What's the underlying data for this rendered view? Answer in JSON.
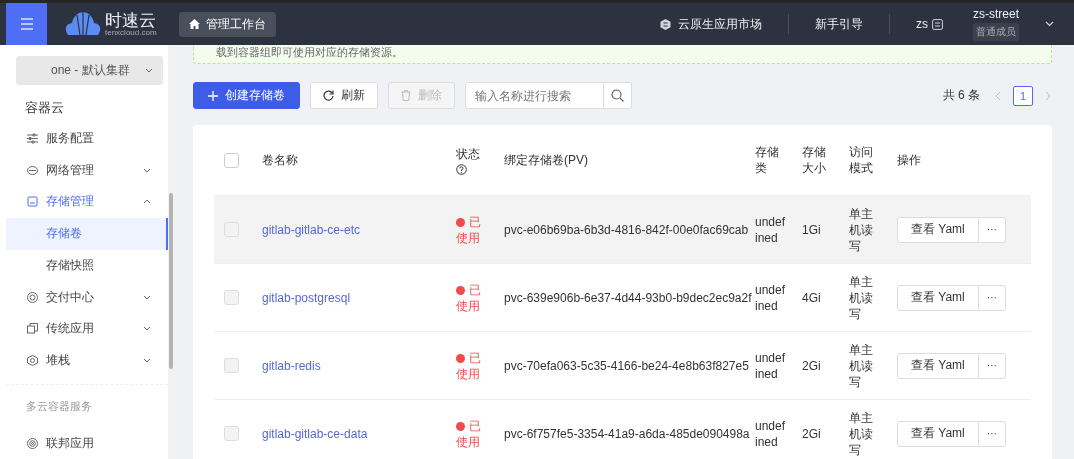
{
  "topbar": {
    "logo_text": "时速云",
    "logo_sub": "tenxcloud.com",
    "workspace": "管理工作台",
    "market": "云原生应用市场",
    "guide": "新手引导",
    "user_short": "zs",
    "user_name": "zs-street",
    "role": "普通成员"
  },
  "sidebar": {
    "cluster": "one - 默认集群",
    "section": "容器云",
    "items": [
      {
        "label": "服务配置",
        "kind": "config",
        "active": false
      },
      {
        "label": "网络管理",
        "kind": "network",
        "expanded": false,
        "active": false
      },
      {
        "label": "存储管理",
        "kind": "storage",
        "expanded": true,
        "active": true,
        "children": [
          {
            "label": "存储卷",
            "selected": true
          },
          {
            "label": "存储快照",
            "selected": false
          }
        ]
      },
      {
        "label": "交付中心",
        "kind": "delivery",
        "expanded": false,
        "active": false
      },
      {
        "label": "传统应用",
        "kind": "app",
        "expanded": false,
        "active": false
      },
      {
        "label": "堆栈",
        "kind": "stack",
        "expanded": false,
        "active": false
      }
    ],
    "group_label": "多云容器服务",
    "group_items": [
      {
        "label": "联邦应用",
        "kind": "federation"
      }
    ]
  },
  "notice": "载到容器组即可使用对应的存储资源。",
  "toolbar": {
    "create": "创建存储卷",
    "refresh": "刷新",
    "delete": {
      "label": "删除",
      "disabled": true
    },
    "search": {
      "placeholder": "输入名称进行搜索"
    }
  },
  "pagination": {
    "total": "共 6 条",
    "pages": [
      {
        "label": "1",
        "selected": true
      }
    ]
  },
  "table": {
    "columns": [
      "卷名称",
      "状态",
      "绑定存储卷(PV)",
      "存储类",
      "存储大小",
      "访问模式",
      "操作"
    ],
    "header_checked": false,
    "rows": [
      {
        "checked": false,
        "hovered": true,
        "name": "gitlab-gitlab-ce-etc",
        "status": "已使用",
        "color": "#f04b4b",
        "pv": "pvc-e06b69ba-6b3d-4816-842f-00e0fac69cab",
        "storage_class": "undefined",
        "size": "1Gi",
        "access": "单主机读写",
        "action": "查看 Yaml",
        "more": "···"
      },
      {
        "checked": false,
        "hovered": false,
        "name": "gitlab-postgresql",
        "status": "已使用",
        "color": "#f04b4b",
        "pv": "pvc-639e906b-6e37-4d44-93b0-b9dec2ec9a2f",
        "storage_class": "undefined",
        "size": "4Gi",
        "access": "单主机读写",
        "action": "查看 Yaml",
        "more": "···"
      },
      {
        "checked": false,
        "hovered": false,
        "name": "gitlab-redis",
        "status": "已使用",
        "color": "#f04b4b",
        "pv": "pvc-70efa063-5c35-4166-be24-4e8b63f827e5",
        "storage_class": "undefined",
        "size": "2Gi",
        "access": "单主机读写",
        "action": "查看 Yaml",
        "more": "···"
      },
      {
        "checked": false,
        "hovered": false,
        "name": "gitlab-gitlab-ce-data",
        "status": "已使用",
        "color": "#f04b4b",
        "pv": "pvc-6f757fe5-3354-41a9-a6da-485de090498a",
        "storage_class": "undefined",
        "size": "2Gi",
        "access": "单主机读写",
        "action": "查看 Yaml",
        "more": "···"
      }
    ]
  }
}
